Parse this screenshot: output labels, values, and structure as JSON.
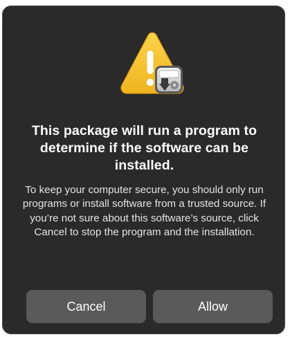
{
  "dialog": {
    "icon": "warning-triangle-with-disk-icon",
    "title": "This package will run a program to determine if the software can be installed.",
    "message": "To keep your computer secure, you should only run programs or install software from a trusted source. If you’re not sure about this software’s source, click Cancel to stop the program and the installation.",
    "buttons": {
      "cancel_label": "Cancel",
      "allow_label": "Allow"
    }
  },
  "colors": {
    "dialog_background": "#2b2a2a",
    "button_background": "#5b5a5a",
    "warning_yellow": "#f5c436",
    "text_primary": "#ffffff"
  }
}
